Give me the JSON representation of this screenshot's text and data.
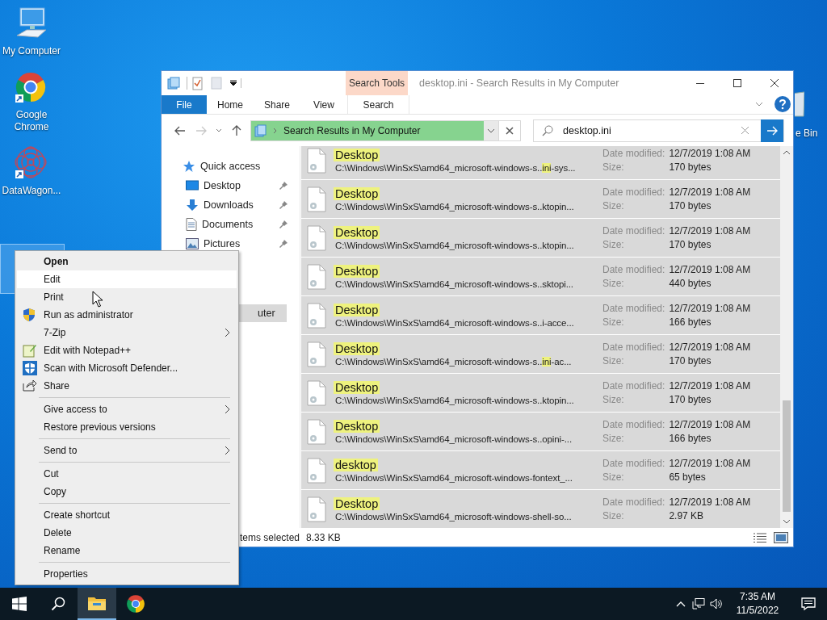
{
  "desktop_icons": [
    {
      "label": "My Computer",
      "kind": "computer",
      "shortcut": false
    },
    {
      "label": "Google Chrome",
      "kind": "chrome",
      "shortcut": true
    },
    {
      "label": "DataWagon...",
      "kind": "mandala",
      "shortcut": true
    }
  ],
  "recycle_bin": {
    "label": "e Bin"
  },
  "window": {
    "title": "desktop.ini - Search Results in My Computer",
    "contextual_header": "Search Tools",
    "ribbon_tabs": [
      {
        "label": "File",
        "kind": "file"
      },
      {
        "label": "Home",
        "kind": "tab"
      },
      {
        "label": "Share",
        "kind": "tab"
      },
      {
        "label": "View",
        "kind": "tab"
      },
      {
        "label": "Search",
        "kind": "contextual"
      }
    ],
    "address": "Search Results in My Computer",
    "search": {
      "value": "desktop.ini"
    },
    "nav": [
      {
        "label": "Quick access",
        "kind": "star",
        "pinned": false,
        "selected": false
      },
      {
        "label": "Desktop",
        "kind": "desktop",
        "pinned": true,
        "selected": false
      },
      {
        "label": "Downloads",
        "kind": "download",
        "pinned": true,
        "selected": false
      },
      {
        "label": "Documents",
        "kind": "document",
        "pinned": true,
        "selected": false
      },
      {
        "label": "Pictures",
        "kind": "picture",
        "pinned": true,
        "selected": false
      },
      {
        "label": "uter",
        "kind": "plain",
        "pinned": false,
        "selected": true
      }
    ],
    "results": [
      {
        "name": "Desktop",
        "name_match": true,
        "path": [
          {
            "text": "C:\\Windows\\WinSxS\\amd64_microsoft-windows-s..",
            "match": false
          },
          {
            "text": "ini",
            "match": true
          },
          {
            "text": "-sys...",
            "match": false
          }
        ],
        "date_label": "Date modified:",
        "date": "12/7/2019 1:08 AM",
        "size_label": "Size:",
        "size": "170 bytes",
        "selected": true
      },
      {
        "name": "Desktop",
        "name_match": true,
        "path": [
          {
            "text": "C:\\Windows\\WinSxS\\amd64_microsoft-windows-s..ktopin...",
            "match": false
          }
        ],
        "date_label": "Date modified:",
        "date": "12/7/2019 1:08 AM",
        "size_label": "Size:",
        "size": "170 bytes",
        "selected": true
      },
      {
        "name": "Desktop",
        "name_match": true,
        "path": [
          {
            "text": "C:\\Windows\\WinSxS\\amd64_microsoft-windows-s..ktopin...",
            "match": false
          }
        ],
        "date_label": "Date modified:",
        "date": "12/7/2019 1:08 AM",
        "size_label": "Size:",
        "size": "170 bytes",
        "selected": true
      },
      {
        "name": "Desktop",
        "name_match": true,
        "path": [
          {
            "text": "C:\\Windows\\WinSxS\\amd64_microsoft-windows-s..sktopi...",
            "match": false
          }
        ],
        "date_label": "Date modified:",
        "date": "12/7/2019 1:08 AM",
        "size_label": "Size:",
        "size": "440 bytes",
        "selected": true
      },
      {
        "name": "Desktop",
        "name_match": true,
        "path": [
          {
            "text": "C:\\Windows\\WinSxS\\amd64_microsoft-windows-s..i-acce...",
            "match": false
          }
        ],
        "date_label": "Date modified:",
        "date": "12/7/2019 1:08 AM",
        "size_label": "Size:",
        "size": "166 bytes",
        "selected": true
      },
      {
        "name": "Desktop",
        "name_match": true,
        "path": [
          {
            "text": "C:\\Windows\\WinSxS\\amd64_microsoft-windows-s..",
            "match": false
          },
          {
            "text": "ini",
            "match": true
          },
          {
            "text": "-ac...",
            "match": false
          }
        ],
        "date_label": "Date modified:",
        "date": "12/7/2019 1:08 AM",
        "size_label": "Size:",
        "size": "170 bytes",
        "selected": true
      },
      {
        "name": "Desktop",
        "name_match": true,
        "path": [
          {
            "text": "C:\\Windows\\WinSxS\\amd64_microsoft-windows-s..ktopin...",
            "match": false
          }
        ],
        "date_label": "Date modified:",
        "date": "12/7/2019 1:08 AM",
        "size_label": "Size:",
        "size": "170 bytes",
        "selected": true
      },
      {
        "name": "Desktop",
        "name_match": true,
        "path": [
          {
            "text": "C:\\Windows\\WinSxS\\amd64_microsoft-windows-s..opini-...",
            "match": false
          }
        ],
        "date_label": "Date modified:",
        "date": "12/7/2019 1:08 AM",
        "size_label": "Size:",
        "size": "166 bytes",
        "selected": true
      },
      {
        "name": "desktop",
        "name_match": true,
        "path": [
          {
            "text": "C:\\Windows\\WinSxS\\amd64_microsoft-windows-fontext_...",
            "match": false
          }
        ],
        "date_label": "Date modified:",
        "date": "12/7/2019 1:08 AM",
        "size_label": "Size:",
        "size": "65 bytes",
        "selected": true
      },
      {
        "name": "Desktop",
        "name_match": true,
        "path": [
          {
            "text": "C:\\Windows\\WinSxS\\amd64_microsoft-windows-shell-so...",
            "match": false
          }
        ],
        "date_label": "Date modified:",
        "date": "12/7/2019 1:08 AM",
        "size_label": "Size:",
        "size": "2.97 KB",
        "selected": true
      }
    ],
    "status": {
      "selection": "tems selected",
      "size": "8.33 KB"
    }
  },
  "context_menu": [
    {
      "kind": "item",
      "label": "Open",
      "bold": true,
      "hovered": false,
      "submenu": false
    },
    {
      "kind": "item",
      "label": "Edit",
      "bold": false,
      "hovered": true,
      "submenu": false
    },
    {
      "kind": "item",
      "label": "Print",
      "bold": false,
      "hovered": false,
      "submenu": false
    },
    {
      "kind": "admin",
      "label": "Run as administrator",
      "bold": false,
      "hovered": false,
      "submenu": false
    },
    {
      "kind": "item",
      "label": "7-Zip",
      "bold": false,
      "hovered": false,
      "submenu": true
    },
    {
      "kind": "notepad",
      "label": "Edit with Notepad++",
      "bold": false,
      "hovered": false,
      "submenu": false
    },
    {
      "kind": "defender",
      "label": "Scan with Microsoft Defender...",
      "bold": false,
      "hovered": false,
      "submenu": false
    },
    {
      "kind": "share",
      "label": "Share",
      "bold": false,
      "hovered": false,
      "submenu": false
    },
    {
      "kind": "separator"
    },
    {
      "kind": "item",
      "label": "Give access to",
      "bold": false,
      "hovered": false,
      "submenu": true
    },
    {
      "kind": "item",
      "label": "Restore previous versions",
      "bold": false,
      "hovered": false,
      "submenu": false
    },
    {
      "kind": "separator"
    },
    {
      "kind": "item",
      "label": "Send to",
      "bold": false,
      "hovered": false,
      "submenu": true
    },
    {
      "kind": "separator"
    },
    {
      "kind": "item",
      "label": "Cut",
      "bold": false,
      "hovered": false,
      "submenu": false
    },
    {
      "kind": "item",
      "label": "Copy",
      "bold": false,
      "hovered": false,
      "submenu": false
    },
    {
      "kind": "separator"
    },
    {
      "kind": "item",
      "label": "Create shortcut",
      "bold": false,
      "hovered": false,
      "submenu": false
    },
    {
      "kind": "item",
      "label": "Delete",
      "bold": false,
      "hovered": false,
      "submenu": false
    },
    {
      "kind": "item",
      "label": "Rename",
      "bold": false,
      "hovered": false,
      "submenu": false
    },
    {
      "kind": "separator"
    },
    {
      "kind": "item",
      "label": "Properties",
      "bold": false,
      "hovered": false,
      "submenu": false
    }
  ],
  "taskbar": {
    "apps": [
      {
        "kind": "explorer",
        "active": true
      },
      {
        "kind": "chrome",
        "active": false
      }
    ],
    "time": "7:35 AM",
    "date": "11/5/2022"
  }
}
